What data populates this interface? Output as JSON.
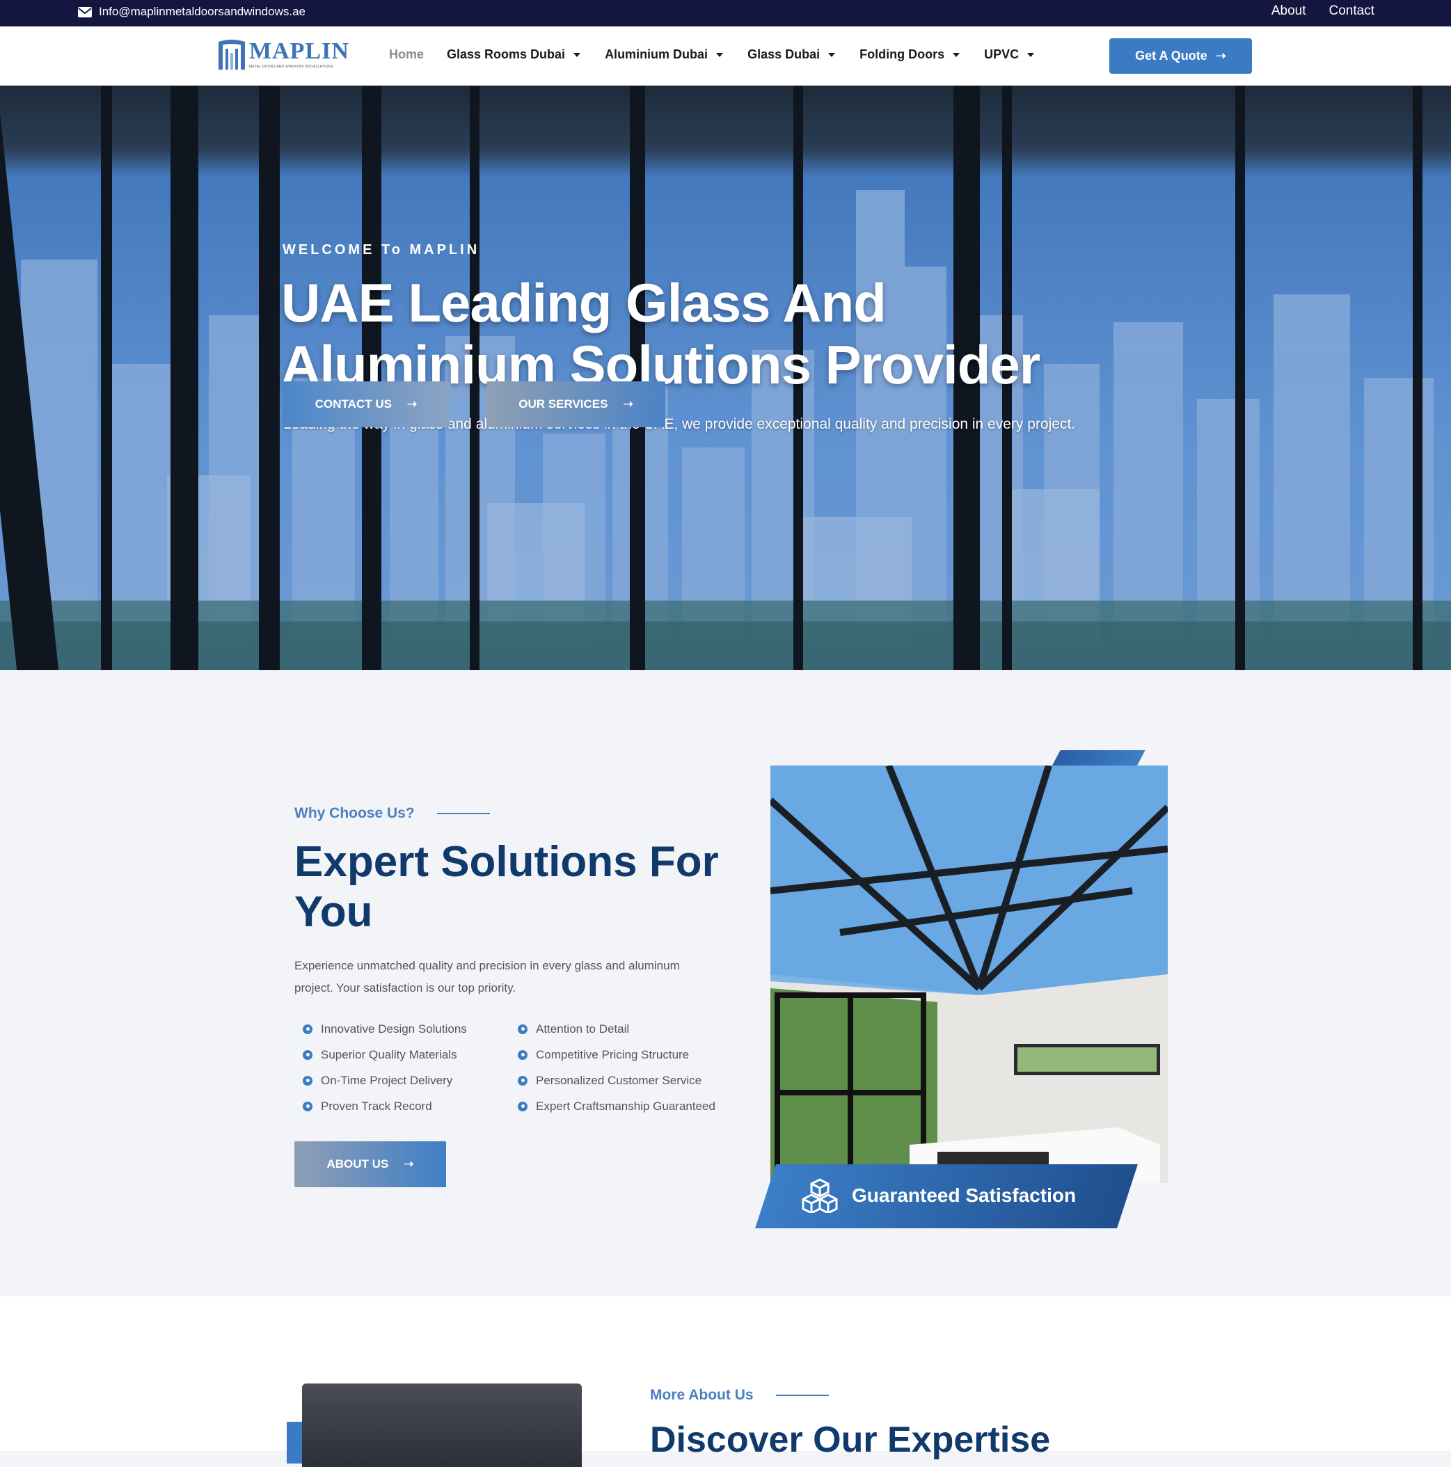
{
  "topbar": {
    "email": "Info@maplinmetaldoorsandwindows.ae",
    "links": [
      "About",
      "Contact"
    ]
  },
  "nav": {
    "logo_text": "MAPLIN",
    "logo_tagline": "METAL DOORS AND WINDOWS INSTALLATIONS",
    "items": [
      {
        "label": "Home",
        "has_dropdown": false
      },
      {
        "label": "Glass Rooms Dubai",
        "has_dropdown": true
      },
      {
        "label": "Aluminium Dubai",
        "has_dropdown": true
      },
      {
        "label": "Glass Dubai",
        "has_dropdown": true
      },
      {
        "label": "Folding Doors",
        "has_dropdown": true
      },
      {
        "label": "UPVC",
        "has_dropdown": true
      }
    ],
    "cta": "Get A Quote"
  },
  "hero": {
    "eyebrow": "WELCOME To MAPLIN",
    "title_line1": "UAE Leading Glass And",
    "title_line2": "Aluminium Solutions Provider",
    "subtitle": "Leading the way in glass and aluminium services in the UAE, we provide exceptional quality and precision in every project.",
    "buttons": [
      "CONTACT US",
      "OUR SERVICES"
    ]
  },
  "why": {
    "eyebrow": "Why Choose Us?",
    "title": "Expert Solutions For You",
    "description": "Experience unmatched quality and precision in every glass and aluminum project. Your satisfaction is our top priority.",
    "features_left": [
      "Innovative Design Solutions",
      "Superior Quality Materials",
      "On-Time Project Delivery",
      "Proven Track Record"
    ],
    "features_right": [
      "Attention to Detail",
      "Competitive Pricing Structure",
      "Personalized Customer Service",
      "Expert Craftsmanship Guaranteed"
    ],
    "button": "ABOUT US",
    "badge": "Guaranteed Satisfaction"
  },
  "more": {
    "eyebrow": "More About Us",
    "title": "Discover Our Expertise"
  },
  "colors": {
    "topbar": "#151640",
    "accent": "#3b7bc4",
    "heading": "#103a6b"
  }
}
